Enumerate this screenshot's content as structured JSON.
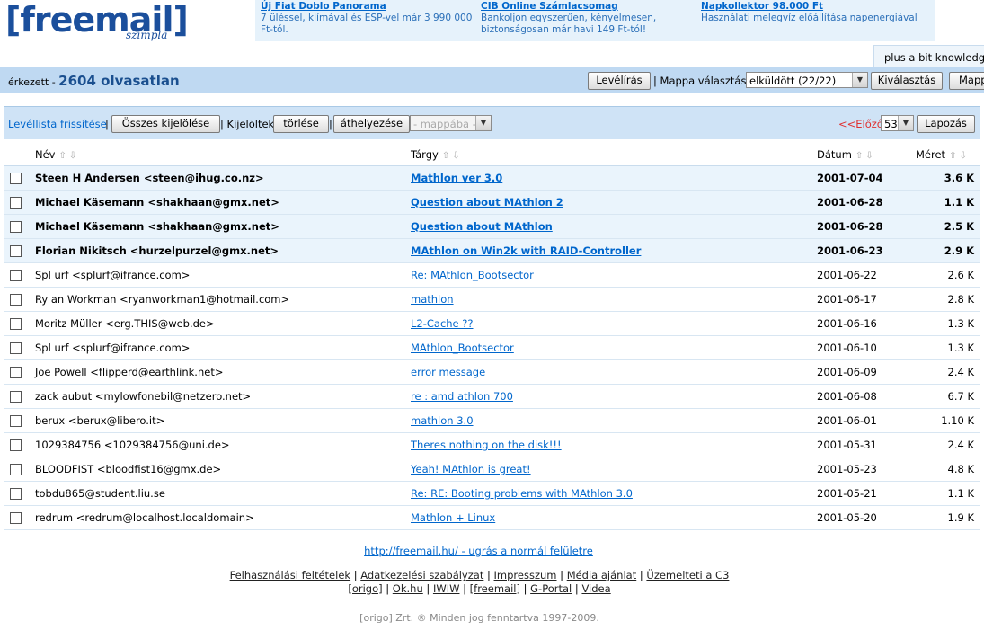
{
  "header": {
    "logo_text": "[freemail]",
    "logo_sub": "szimpla",
    "tagline": "plus a bit knowledge",
    "ads": [
      {
        "title": "Új Fiat Doblo Panorama",
        "desc": "7 üléssel, klímával és ESP-vel már 3 990 000 Ft-tól."
      },
      {
        "title": "CIB Online Számlacsomag",
        "desc": "Bankoljon egyszerűen, kényelmesen, biztonságosan már havi 149 Ft-tól!"
      },
      {
        "title": "Napkollektor 98.000 Ft",
        "desc": "Használati melegvíz előállítása napenergiával"
      }
    ]
  },
  "toolbar": {
    "folder_prefix": "érkezett - ",
    "unread": "2604 olvasatlan",
    "compose": "Levélírás",
    "folder_select_label": "| Mappa választás:",
    "folder_select_value": "elküldött (22/22)",
    "select_button": "Kiválasztás",
    "folders_button": "Mappák",
    "refresh": "Levéllista frissítése",
    "select_all": "Összes kijelölése",
    "selected_label": "| Kijelöltek",
    "delete": "törlése",
    "move": "áthelyezése",
    "move_target": "- mappába -",
    "prev": "<<Előző",
    "page": "53",
    "paging": "Lapozás",
    "sep": "|"
  },
  "columns": {
    "name": "Név",
    "subject": "Tárgy",
    "date": "Dátum",
    "size": "Méret",
    "sort_icons": "⇧⇩"
  },
  "messages": [
    {
      "name": "Steen H Andersen <steen@ihug.co.nz>",
      "subject": "Mathlon ver 3.0",
      "date": "2001-07-04",
      "size": "3.6 K"
    },
    {
      "name": "Michael Käsemann <shakhaan@gmx.net>",
      "subject": "Question about MAthlon 2",
      "date": "2001-06-28",
      "size": "1.1 K"
    },
    {
      "name": "Michael Käsemann <shakhaan@gmx.net>",
      "subject": "Question about MAthlon",
      "date": "2001-06-28",
      "size": "2.5 K"
    },
    {
      "name": "Florian Nikitsch <hurzelpurzel@gmx.net>",
      "subject": "MAthlon on Win2k with RAID-Controller",
      "date": "2001-06-23",
      "size": "2.9 K"
    },
    {
      "name": "Spl urf <splurf@ifrance.com>",
      "subject": "Re: MAthlon_Bootsector",
      "date": "2001-06-22",
      "size": "2.6 K"
    },
    {
      "name": "Ry an Workman <ryanworkman1@hotmail.com>",
      "subject": "mathlon",
      "date": "2001-06-17",
      "size": "2.8 K"
    },
    {
      "name": "Moritz Müller <erg.THIS@web.de>",
      "subject": "L2-Cache ??",
      "date": "2001-06-16",
      "size": "1.3 K"
    },
    {
      "name": "Spl urf <splurf@ifrance.com>",
      "subject": "MAthlon_Bootsector",
      "date": "2001-06-10",
      "size": "1.3 K"
    },
    {
      "name": "Joe Powell <flipperd@earthlink.net>",
      "subject": "error message",
      "date": "2001-06-09",
      "size": "2.4 K"
    },
    {
      "name": "zack aubut <mylowfonebil@netzero.net>",
      "subject": "re : amd athlon 700",
      "date": "2001-06-08",
      "size": "6.7 K"
    },
    {
      "name": "berux <berux@libero.it>",
      "subject": "mathlon 3.0",
      "date": "2001-06-01",
      "size": "1.10 K"
    },
    {
      "name": "1029384756 <1029384756@uni.de>",
      "subject": "Theres nothing on the disk!!!",
      "date": "2001-05-31",
      "size": "2.4 K"
    },
    {
      "name": "BLOODFIST <bloodfist16@gmx.de>",
      "subject": "Yeah! MAthlon is great!",
      "date": "2001-05-23",
      "size": "4.8 K"
    },
    {
      "name": "tobdu865@student.liu.se",
      "subject": "Re: RE: Booting problems with MAthlon 3.0",
      "date": "2001-05-21",
      "size": "1.1 K"
    },
    {
      "name": "redrum <redrum@localhost.localdomain>",
      "subject": "Mathlon + Linux",
      "date": "2001-05-20",
      "size": "1.9 K"
    }
  ],
  "footer": {
    "home_link": "http://freemail.hu/ - ugrás a normál felületre",
    "links1": [
      "Felhasználási feltételek",
      "Adatkezelési szabályzat",
      "Impresszum",
      "Média ajánlat",
      "Üzemelteti a C3"
    ],
    "links2": [
      "[origo]",
      "Ok.hu",
      "IWIW",
      "[freemail]",
      "G-Portal",
      "Videa"
    ],
    "copyright": "[origo] Zrt. ® Minden jog fenntartva 1997-2009."
  }
}
